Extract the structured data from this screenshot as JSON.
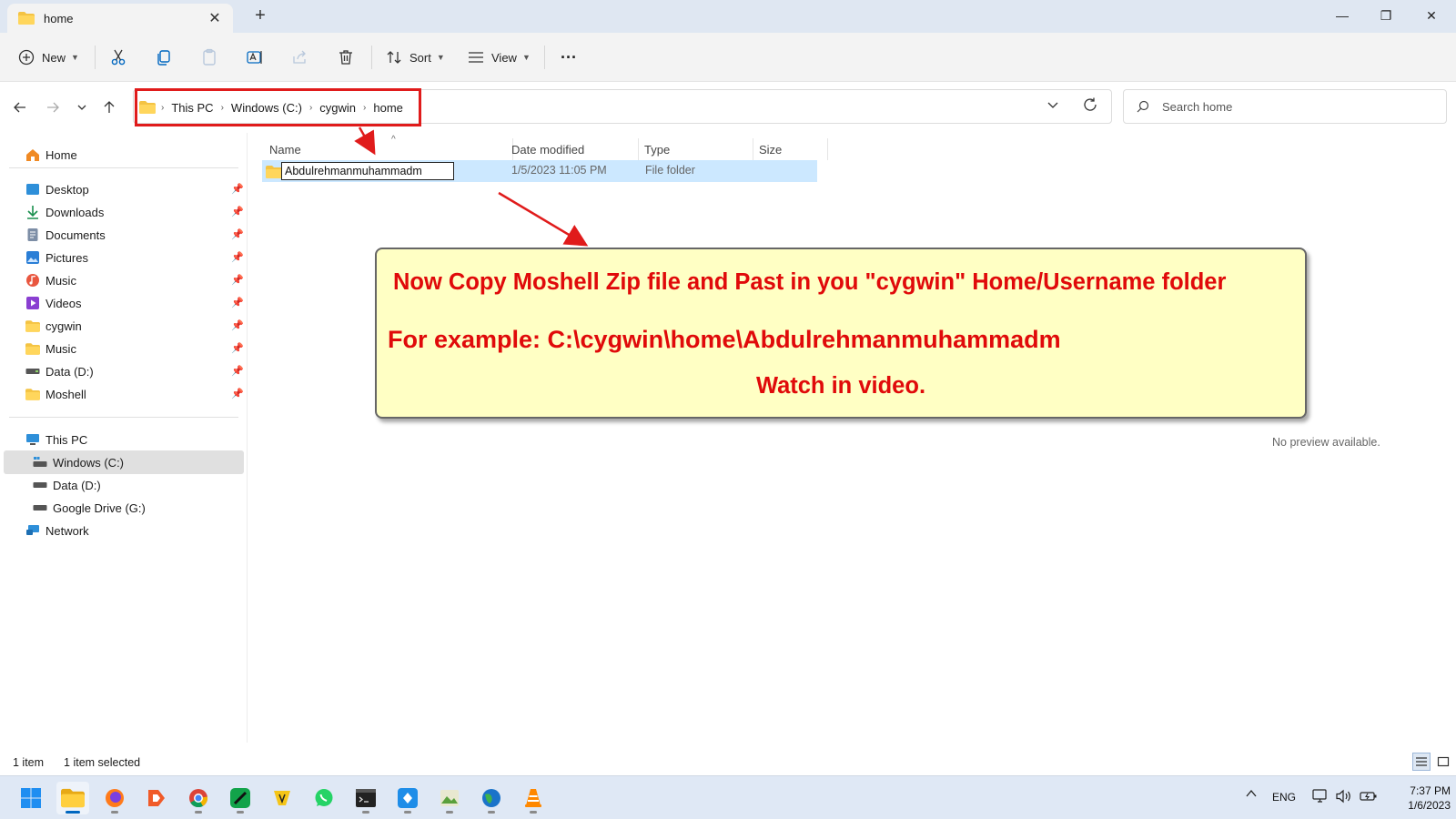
{
  "window": {
    "tab_title": "home",
    "tab_close": "✕",
    "new_tab": "+",
    "minimize": "—",
    "maximize": "❐",
    "close": "✕"
  },
  "toolbar": {
    "new_label": "New",
    "sort_label": "Sort",
    "view_label": "View",
    "more_label": "···"
  },
  "address": {
    "breadcrumbs": [
      "This PC",
      "Windows (C:)",
      "cygwin",
      "home"
    ],
    "search_placeholder": "Search home"
  },
  "sidebar": {
    "home": "Home",
    "quick_access": [
      {
        "label": "Desktop",
        "icon": "desktop-icon"
      },
      {
        "label": "Downloads",
        "icon": "download-icon"
      },
      {
        "label": "Documents",
        "icon": "documents-icon"
      },
      {
        "label": "Pictures",
        "icon": "pictures-icon"
      },
      {
        "label": "Music",
        "icon": "music-icon"
      },
      {
        "label": "Videos",
        "icon": "videos-icon"
      },
      {
        "label": "cygwin",
        "icon": "folder-icon"
      },
      {
        "label": "Music",
        "icon": "folder-icon"
      },
      {
        "label": "Data (D:)",
        "icon": "drive-icon"
      },
      {
        "label": "Moshell",
        "icon": "folder-icon"
      }
    ],
    "this_pc": "This PC",
    "drives": [
      "Windows (C:)",
      "Data (D:)",
      "Google Drive (G:)"
    ],
    "network": "Network"
  },
  "filelist": {
    "columns": [
      "Name",
      "Date modified",
      "Type",
      "Size"
    ],
    "rows": [
      {
        "name": "Abdulrehmanmuhammadm",
        "date": "1/5/2023 11:05 PM",
        "type": "File folder",
        "size": ""
      }
    ],
    "preview_text": "No preview available."
  },
  "annotation": {
    "line1": "Now Copy Moshell Zip file and Past in you \"cygwin\" Home/Username folder",
    "line2": "For example: C:\\cygwin\\home\\Abdulrehmanmuhammadm",
    "line3": "Watch in video."
  },
  "status": {
    "item_count": "1 item",
    "selected": "1 item selected"
  },
  "taskbar": {
    "language": "ENG",
    "time": "7:37 PM",
    "date": "1/6/2023"
  },
  "colors": {
    "accent": "#0067c0",
    "annotation_red": "#e00a0a",
    "annotation_bg": "#ffffc4",
    "selection": "#cce8ff"
  }
}
